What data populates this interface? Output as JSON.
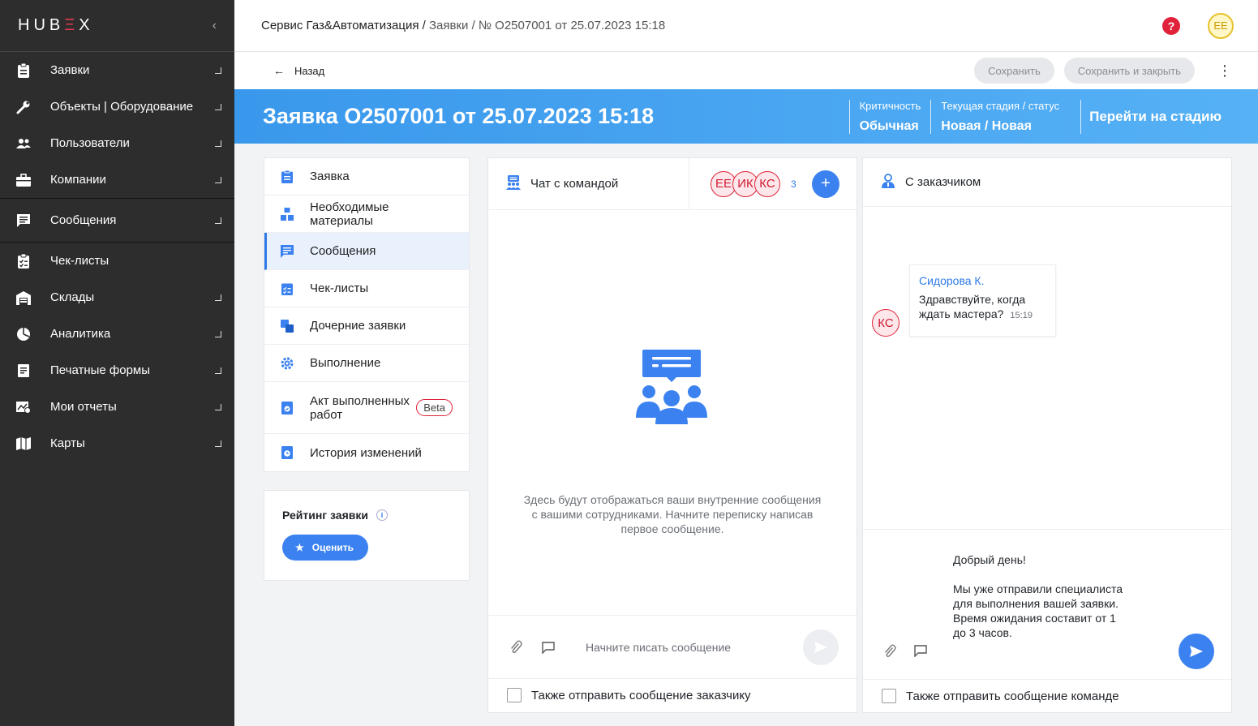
{
  "app": {
    "logo_text": "HUB",
    "logo_x": "Ξ",
    "logo_x_after": "X"
  },
  "sidebar": {
    "items": [
      {
        "label": "Заявки",
        "icon": "clipboard-icon"
      },
      {
        "label": "Объекты | Оборудование",
        "icon": "wrench-icon"
      },
      {
        "label": "Пользователи",
        "icon": "users-icon"
      },
      {
        "label": "Компании",
        "icon": "briefcase-icon"
      },
      {
        "label": "Сообщения",
        "icon": "message-icon"
      },
      {
        "label": "Чек-листы",
        "icon": "checklist-icon"
      },
      {
        "label": "Склады",
        "icon": "warehouse-icon"
      },
      {
        "label": "Аналитика",
        "icon": "pie-chart-icon"
      },
      {
        "label": "Печатные формы",
        "icon": "print-form-icon"
      },
      {
        "label": "Мои отчеты",
        "icon": "report-icon"
      },
      {
        "label": "Карты",
        "icon": "map-icon"
      }
    ]
  },
  "header": {
    "breadcrumb_company": "Сервис Газ&Автоматизация",
    "breadcrumb_sep": " / ",
    "breadcrumb_rest": "Заявки / № О2507001 от 25.07.2023 15:18",
    "help": "?",
    "user_initials": "ЕЕ"
  },
  "actions": {
    "back": "Назад",
    "save": "Сохранить",
    "save_close": "Сохранить и закрыть",
    "more": "⋮"
  },
  "ticket": {
    "title": "Заявка О2507001 от 25.07.2023 15:18",
    "criticality_label": "Критичность",
    "criticality_value": "Обычная",
    "stage_label": "Текущая стадия / статус",
    "stage_value": "Новая / Новая",
    "go_stage": "Перейти на стадию"
  },
  "left_menu": {
    "items": [
      {
        "label": "Заявка"
      },
      {
        "label": "Необходимые материалы"
      },
      {
        "label": "Сообщения"
      },
      {
        "label": "Чек-листы"
      },
      {
        "label": "Дочерние заявки"
      },
      {
        "label": "Выполнение"
      },
      {
        "label": "Акт выполненных работ",
        "badge": "Beta"
      },
      {
        "label": "История изменений"
      }
    ],
    "active_index": 2
  },
  "rating": {
    "title": "Рейтинг заявки",
    "info": "i",
    "button": "Оценить"
  },
  "team_chat": {
    "title": "Чат с командой",
    "members": [
      "ЕЕ",
      "ИК",
      "КС"
    ],
    "member_count": "3",
    "add": "+",
    "empty_text": "Здесь будут отображаться ваши внутренние сообщения с вашими сотрудниками. Начните переписку написав первое сообщение.",
    "placeholder": "Начните писать сообщение",
    "checkbox_label": "Также отправить сообщение заказчику"
  },
  "customer_chat": {
    "title": "С заказчиком",
    "message": {
      "author": "Сидорова К.",
      "avatar": "КС",
      "text": "Здравствуйте, когда ждать мастера?",
      "time": "15:19"
    },
    "draft": "Добрый день!\n\nМы уже отправили специалиста для выполнения вашей заявки. Время ожидания составит от 1 до 3 часов.",
    "checkbox_label": "Также отправить сообщение команде"
  },
  "colors": {
    "accent": "#3b82f0",
    "brand_red": "#e0223a",
    "sidebar": "#2d2d2d"
  }
}
